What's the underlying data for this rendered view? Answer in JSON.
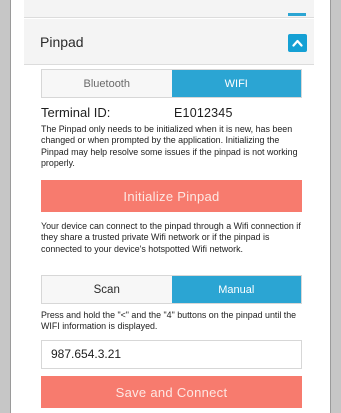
{
  "panel": {
    "title": "Pinpad",
    "collapse_icon": "chevron-up-icon",
    "accent": "#2ba5d3",
    "action_color": "#f77b6e"
  },
  "connection_tabs": {
    "bluetooth_label": "Bluetooth",
    "wifi_label": "WIFI",
    "selected": "WIFI"
  },
  "terminal": {
    "label": "Terminal ID:",
    "value": "E1012345"
  },
  "texts": {
    "init_info": "The Pinpad only needs to be initialized when it is new, has been changed or when prompted by the application. Initializing the Pinpad may help resolve some issues if the pinpad is not working properly.",
    "wifi_info": "Your device can connect to the pinpad through a Wifi connection if they share a trusted private Wifi network or if the pinpad is connected to your device's hotspotted Wifi network.",
    "manual_info": "Press and hold the \"<\" and the \"4\" buttons on the pinpad until the WIFI information is displayed."
  },
  "buttons": {
    "initialize_label": "Initialize Pinpad",
    "save_connect_label": "Save and Connect"
  },
  "mode_tabs": {
    "scan_label": "Scan",
    "manual_label": "Manual",
    "selected": "Manual"
  },
  "ip_field": {
    "value": "987.654.3.21"
  }
}
